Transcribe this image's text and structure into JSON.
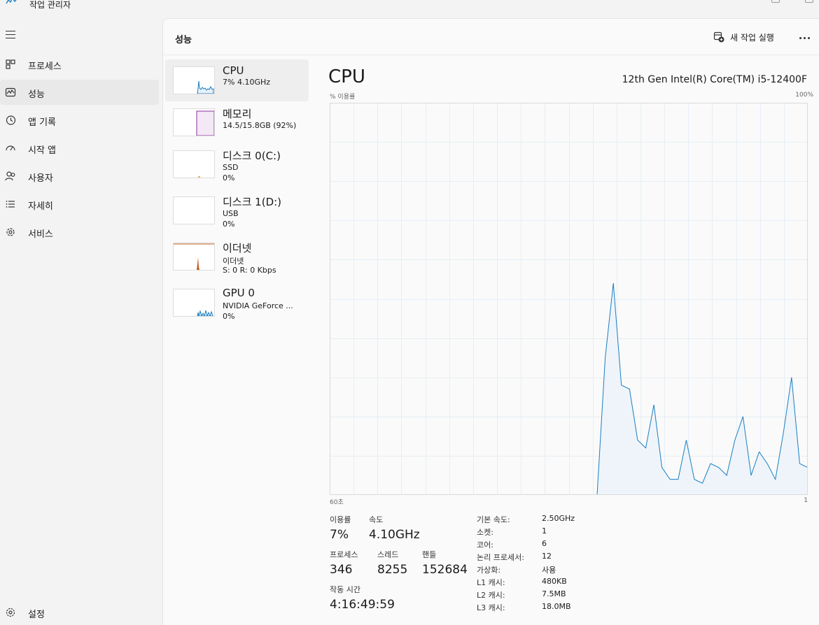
{
  "window": {
    "title": "작업 관리자"
  },
  "sidebar": {
    "items": [
      {
        "label": "프로세스",
        "icon": "processes-icon"
      },
      {
        "label": "성능",
        "icon": "performance-icon",
        "active": true
      },
      {
        "label": "앱 기록",
        "icon": "app-history-icon"
      },
      {
        "label": "시작 앱",
        "icon": "startup-apps-icon"
      },
      {
        "label": "사용자",
        "icon": "users-icon"
      },
      {
        "label": "자세히",
        "icon": "details-icon"
      },
      {
        "label": "서비스",
        "icon": "services-icon"
      }
    ],
    "settings_label": "설정"
  },
  "header": {
    "title": "성능",
    "new_task_label": "새 작업 실행"
  },
  "devices": [
    {
      "name": "CPU",
      "sub1": "7% 4.10GHz",
      "sub2": "",
      "color": "#1a7fc1"
    },
    {
      "name": "메모리",
      "sub1": "14.5/15.8GB (92%)",
      "sub2": "",
      "color": "#8b2fa0"
    },
    {
      "name": "디스크 0(C:)",
      "sub1": "SSD",
      "sub2": "0%",
      "color": "#4e9a06"
    },
    {
      "name": "디스크 1(D:)",
      "sub1": "USB",
      "sub2": "0%",
      "color": "#4e9a06"
    },
    {
      "name": "이더넷",
      "sub1": "이더넷",
      "sub2": "S: 0 R: 0 Kbps",
      "color": "#c25a1b"
    },
    {
      "name": "GPU 0",
      "sub1": "NVIDIA GeForce ...",
      "sub2": "0%",
      "color": "#1a7fc1"
    }
  ],
  "detail": {
    "title": "CPU",
    "model": "12th Gen Intel(R) Core(TM) i5-12400F",
    "y_label": "% 이용률",
    "y_max_label": "100%",
    "x_left_label": "60초",
    "x_right_label": "1",
    "stats": {
      "utilization_label": "이용률",
      "utilization": "7%",
      "speed_label": "속도",
      "speed": "4.10GHz",
      "processes_label": "프로세스",
      "processes": "346",
      "threads_label": "스레드",
      "threads": "8255",
      "handles_label": "핸들",
      "handles": "152684",
      "uptime_label": "작동 시간",
      "uptime": "4:16:49:59"
    },
    "specs": [
      {
        "label": "기본 속도:",
        "value": "2.50GHz"
      },
      {
        "label": "소켓:",
        "value": "1"
      },
      {
        "label": "코어:",
        "value": "6"
      },
      {
        "label": "논리 프로세서:",
        "value": "12"
      },
      {
        "label": "가상화:",
        "value": "사용"
      },
      {
        "label": "L1 캐시:",
        "value": "480KB"
      },
      {
        "label": "L2 캐시:",
        "value": "7.5MB"
      },
      {
        "label": "L3 캐시:",
        "value": "18.0MB"
      }
    ]
  },
  "chart_data": {
    "type": "area",
    "ylim": [
      0,
      100
    ],
    "x_window_seconds": 60,
    "grid": true,
    "color": "#1a7fc1",
    "x": [
      0,
      1,
      2,
      3,
      4,
      5,
      6,
      7,
      8,
      9,
      10,
      11,
      12,
      13,
      14,
      15,
      16,
      17,
      18,
      19,
      20,
      21,
      22,
      23,
      24,
      25,
      26,
      27,
      28,
      29,
      30,
      31,
      32,
      33,
      34,
      35,
      36,
      37,
      38,
      39,
      40,
      41,
      42,
      43,
      44,
      45,
      46,
      47,
      48,
      49,
      50,
      51,
      52,
      53,
      54,
      55,
      56,
      57,
      58,
      59
    ],
    "values": [
      0,
      0,
      0,
      0,
      0,
      0,
      0,
      0,
      0,
      0,
      0,
      0,
      0,
      0,
      0,
      0,
      0,
      0,
      0,
      0,
      0,
      0,
      0,
      0,
      0,
      0,
      0,
      0,
      0,
      0,
      0,
      0,
      0,
      0,
      35,
      54,
      28,
      27,
      14,
      12,
      23,
      7,
      4,
      4,
      14,
      4,
      3,
      8,
      7,
      5,
      14,
      20,
      5,
      11,
      8,
      4,
      16,
      30,
      8,
      7
    ]
  }
}
